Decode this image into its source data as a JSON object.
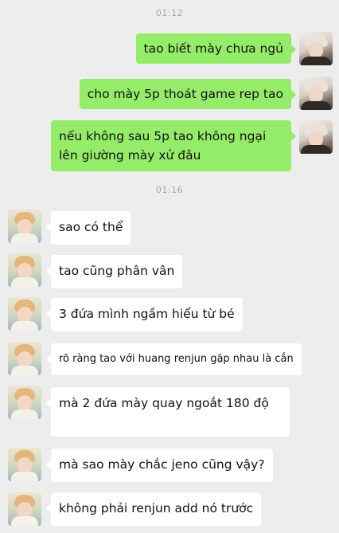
{
  "timestamps": [
    "01:12",
    "01:16"
  ],
  "messages": [
    {
      "side": "right",
      "text": "tao biết mày chưa ngủ"
    },
    {
      "side": "right",
      "text": "cho mày 5p thoát game rep tao"
    },
    {
      "side": "right",
      "lines": [
        "nếu không sau 5p tao không ngại",
        "lên giường mày xử đâu"
      ]
    },
    {
      "side": "left",
      "text": "sao có thể"
    },
    {
      "side": "left",
      "text": "tao cũng phân vân"
    },
    {
      "side": "left",
      "text": "3 đứa mình ngầm hiểu từ bé"
    },
    {
      "side": "left",
      "text": "rõ ràng tao với huang renjun gặp nhau là cắn"
    },
    {
      "side": "left",
      "text": "mà 2 đứa mày quay ngoắt 180 độ"
    },
    {
      "side": "left",
      "text": "mà sao mày chắc jeno cũng vậy?"
    },
    {
      "side": "left",
      "text": "không phải renjun add nó trước"
    }
  ],
  "avatars": {
    "right": "avatar-photo-blonde-boy",
    "left": "avatar-photo-cartoon-boy"
  }
}
